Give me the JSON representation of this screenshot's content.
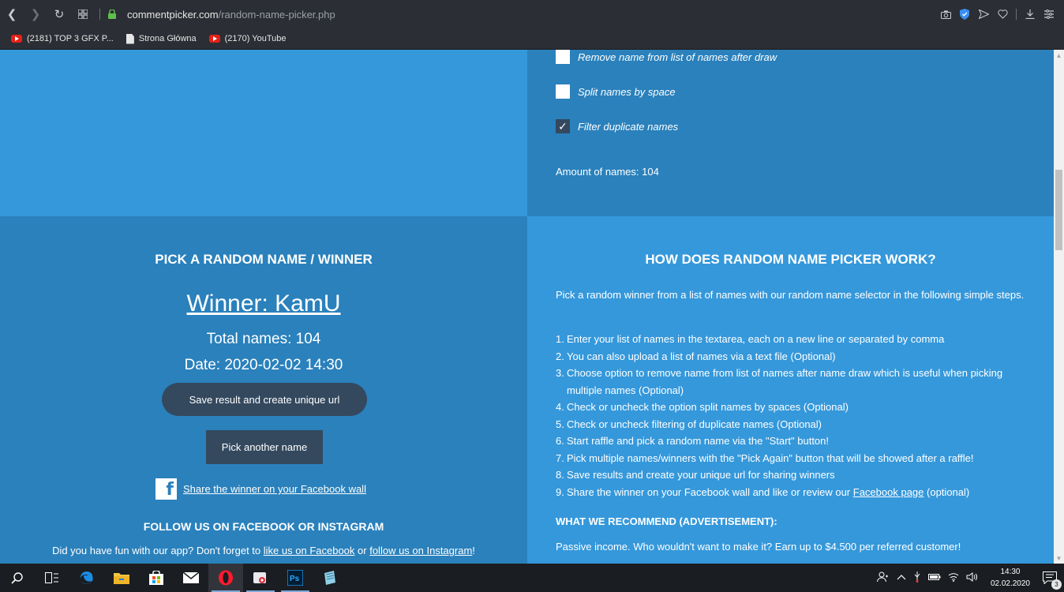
{
  "browser": {
    "url_host": "commentpicker.com",
    "url_path": "/random-name-picker.php",
    "bookmarks": [
      {
        "label": "(2181) TOP 3 GFX P...",
        "icon": "youtube-icon"
      },
      {
        "label": "Strona Główna",
        "icon": "document-icon"
      },
      {
        "label": "(2170) YouTube",
        "icon": "youtube-icon"
      }
    ]
  },
  "options": {
    "remove_label": "Remove name from list of names after draw",
    "remove_checked": false,
    "split_label": "Split names by space",
    "split_checked": false,
    "filter_label": "Filter duplicate names",
    "filter_checked": true,
    "checkmark": "✓",
    "amount": "Amount of names: 104"
  },
  "result": {
    "title": "PICK A RANDOM NAME / WINNER",
    "winner": "Winner: KamU",
    "total": "Total names: 104",
    "date": "Date: 2020-02-02 14:30",
    "save_label": "Save result and create unique url",
    "again_label": "Pick another name",
    "share_label": "Share the winner on your Facebook wall",
    "follow_title": "FOLLOW US ON FACEBOOK OR INSTAGRAM",
    "follow_prefix": "Did you have fun with our app? Don't forget to",
    "follow_fb": "like us on Facebook",
    "follow_or": "or",
    "follow_ig": "follow us on Instagram",
    "follow_suffix": "!"
  },
  "how": {
    "title": "HOW DOES RANDOM NAME PICKER WORK?",
    "intro": "Pick a random winner from a list of names with our random name selector in the following simple steps.",
    "steps": [
      {
        "n": "1.",
        "text": "Enter your list of names in the textarea, each on a new line or separated by comma"
      },
      {
        "n": "2.",
        "text": "You can also upload a list of names via a text file (Optional)"
      },
      {
        "n": "3.",
        "text": "Choose option to remove name from list of names after name draw which is useful when picking multiple names (Optional)"
      },
      {
        "n": "4.",
        "text": "Check or uncheck the option split names by spaces (Optional)"
      },
      {
        "n": "5.",
        "text": "Check or uncheck filtering of duplicate names (Optional)"
      },
      {
        "n": "6.",
        "text": "Start raffle and pick a random name via the \"Start\" button!"
      },
      {
        "n": "7.",
        "text": "Pick multiple names/winners with the \"Pick Again\" button that will be showed after a raffle!"
      },
      {
        "n": "8.",
        "text": "Save results and create your unique url for sharing winners"
      }
    ],
    "step9_n": "9.",
    "step9_prefix": "Share the winner on your Facebook wall and like or review our",
    "step9_link": "Facebook page",
    "step9_suffix": "(optional)",
    "rec_title": "WHAT WE RECOMMEND (ADVERTISEMENT):",
    "passive": "Passive income. Who wouldn't want to make it? Earn up to $4.500 per referred customer!"
  },
  "taskbar": {
    "time": "14:30",
    "date": "02.02.2020",
    "notifications": "3"
  },
  "colors": {
    "light_blue": "#3598db",
    "dark_blue": "#2a81bc",
    "button": "#34495e"
  }
}
